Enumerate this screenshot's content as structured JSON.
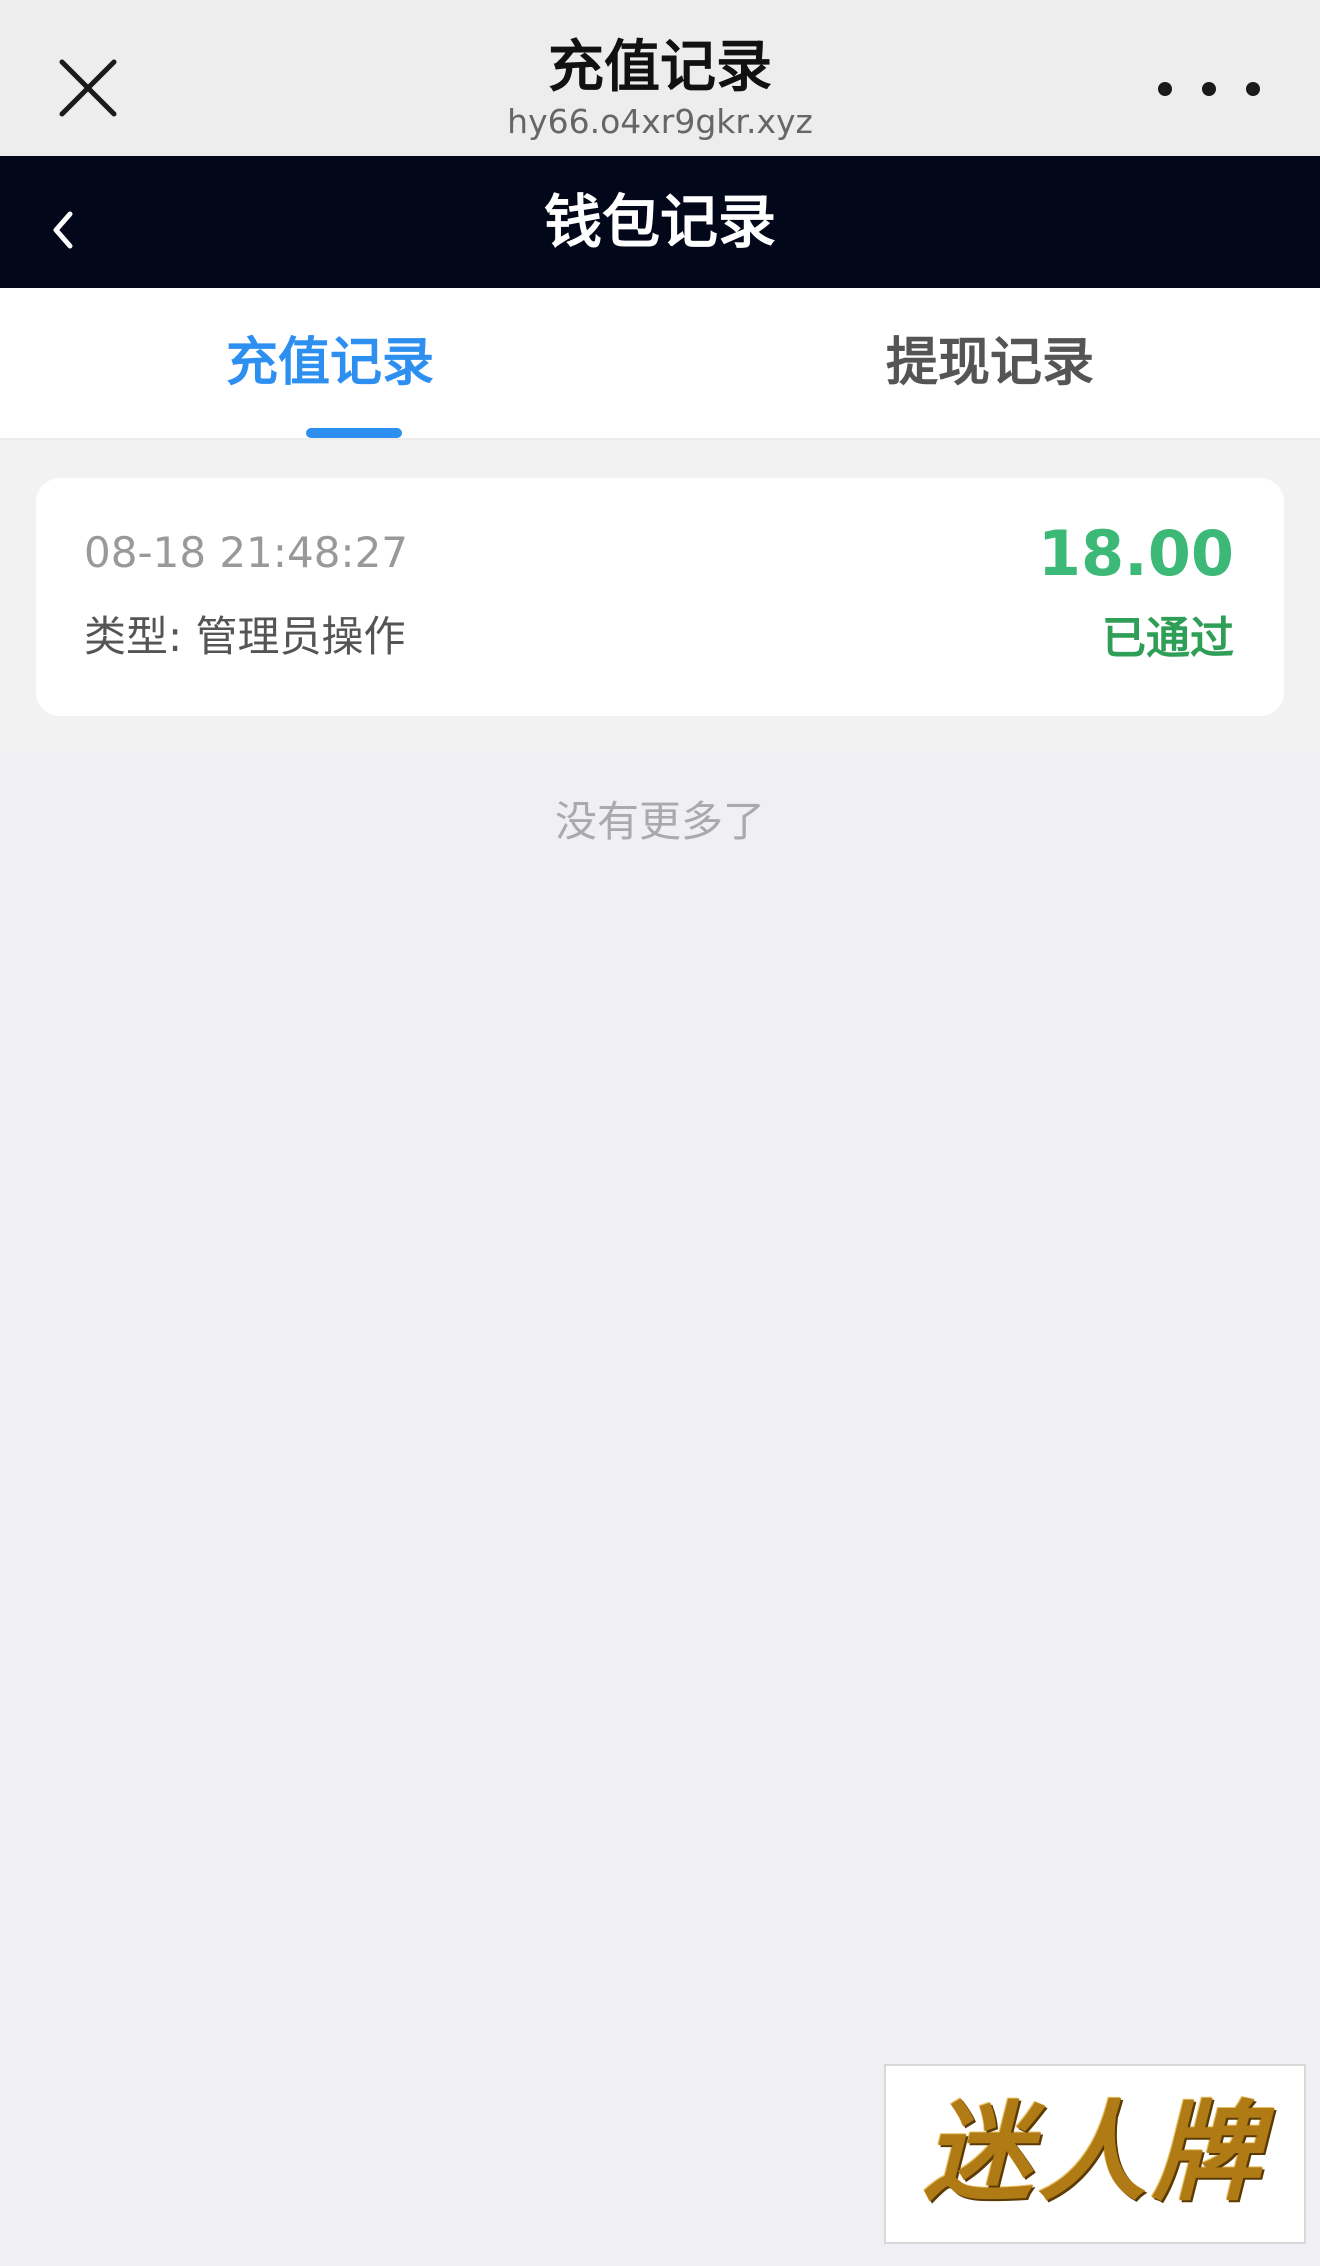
{
  "browser": {
    "title": "充值记录",
    "url": "hy66.o4xr9gkr.xyz",
    "close_icon": "close-icon",
    "more_icon": "more-icon"
  },
  "header": {
    "title": "钱包记录",
    "back_icon": "chevron-left-icon"
  },
  "tabs": [
    {
      "label": "充值记录",
      "active": true
    },
    {
      "label": "提现记录",
      "active": false
    }
  ],
  "records": [
    {
      "time": "08-18 21:48:27",
      "type": "类型: 管理员操作",
      "amount": "18.00",
      "status": "已通过"
    }
  ],
  "footer": {
    "no_more": "没有更多了"
  },
  "ad": {
    "label": "迷人牌"
  },
  "colors": {
    "accent": "#2d8ff0",
    "header_bg": "#020719",
    "amount": "#3cb977",
    "status": "#2f9e57"
  }
}
